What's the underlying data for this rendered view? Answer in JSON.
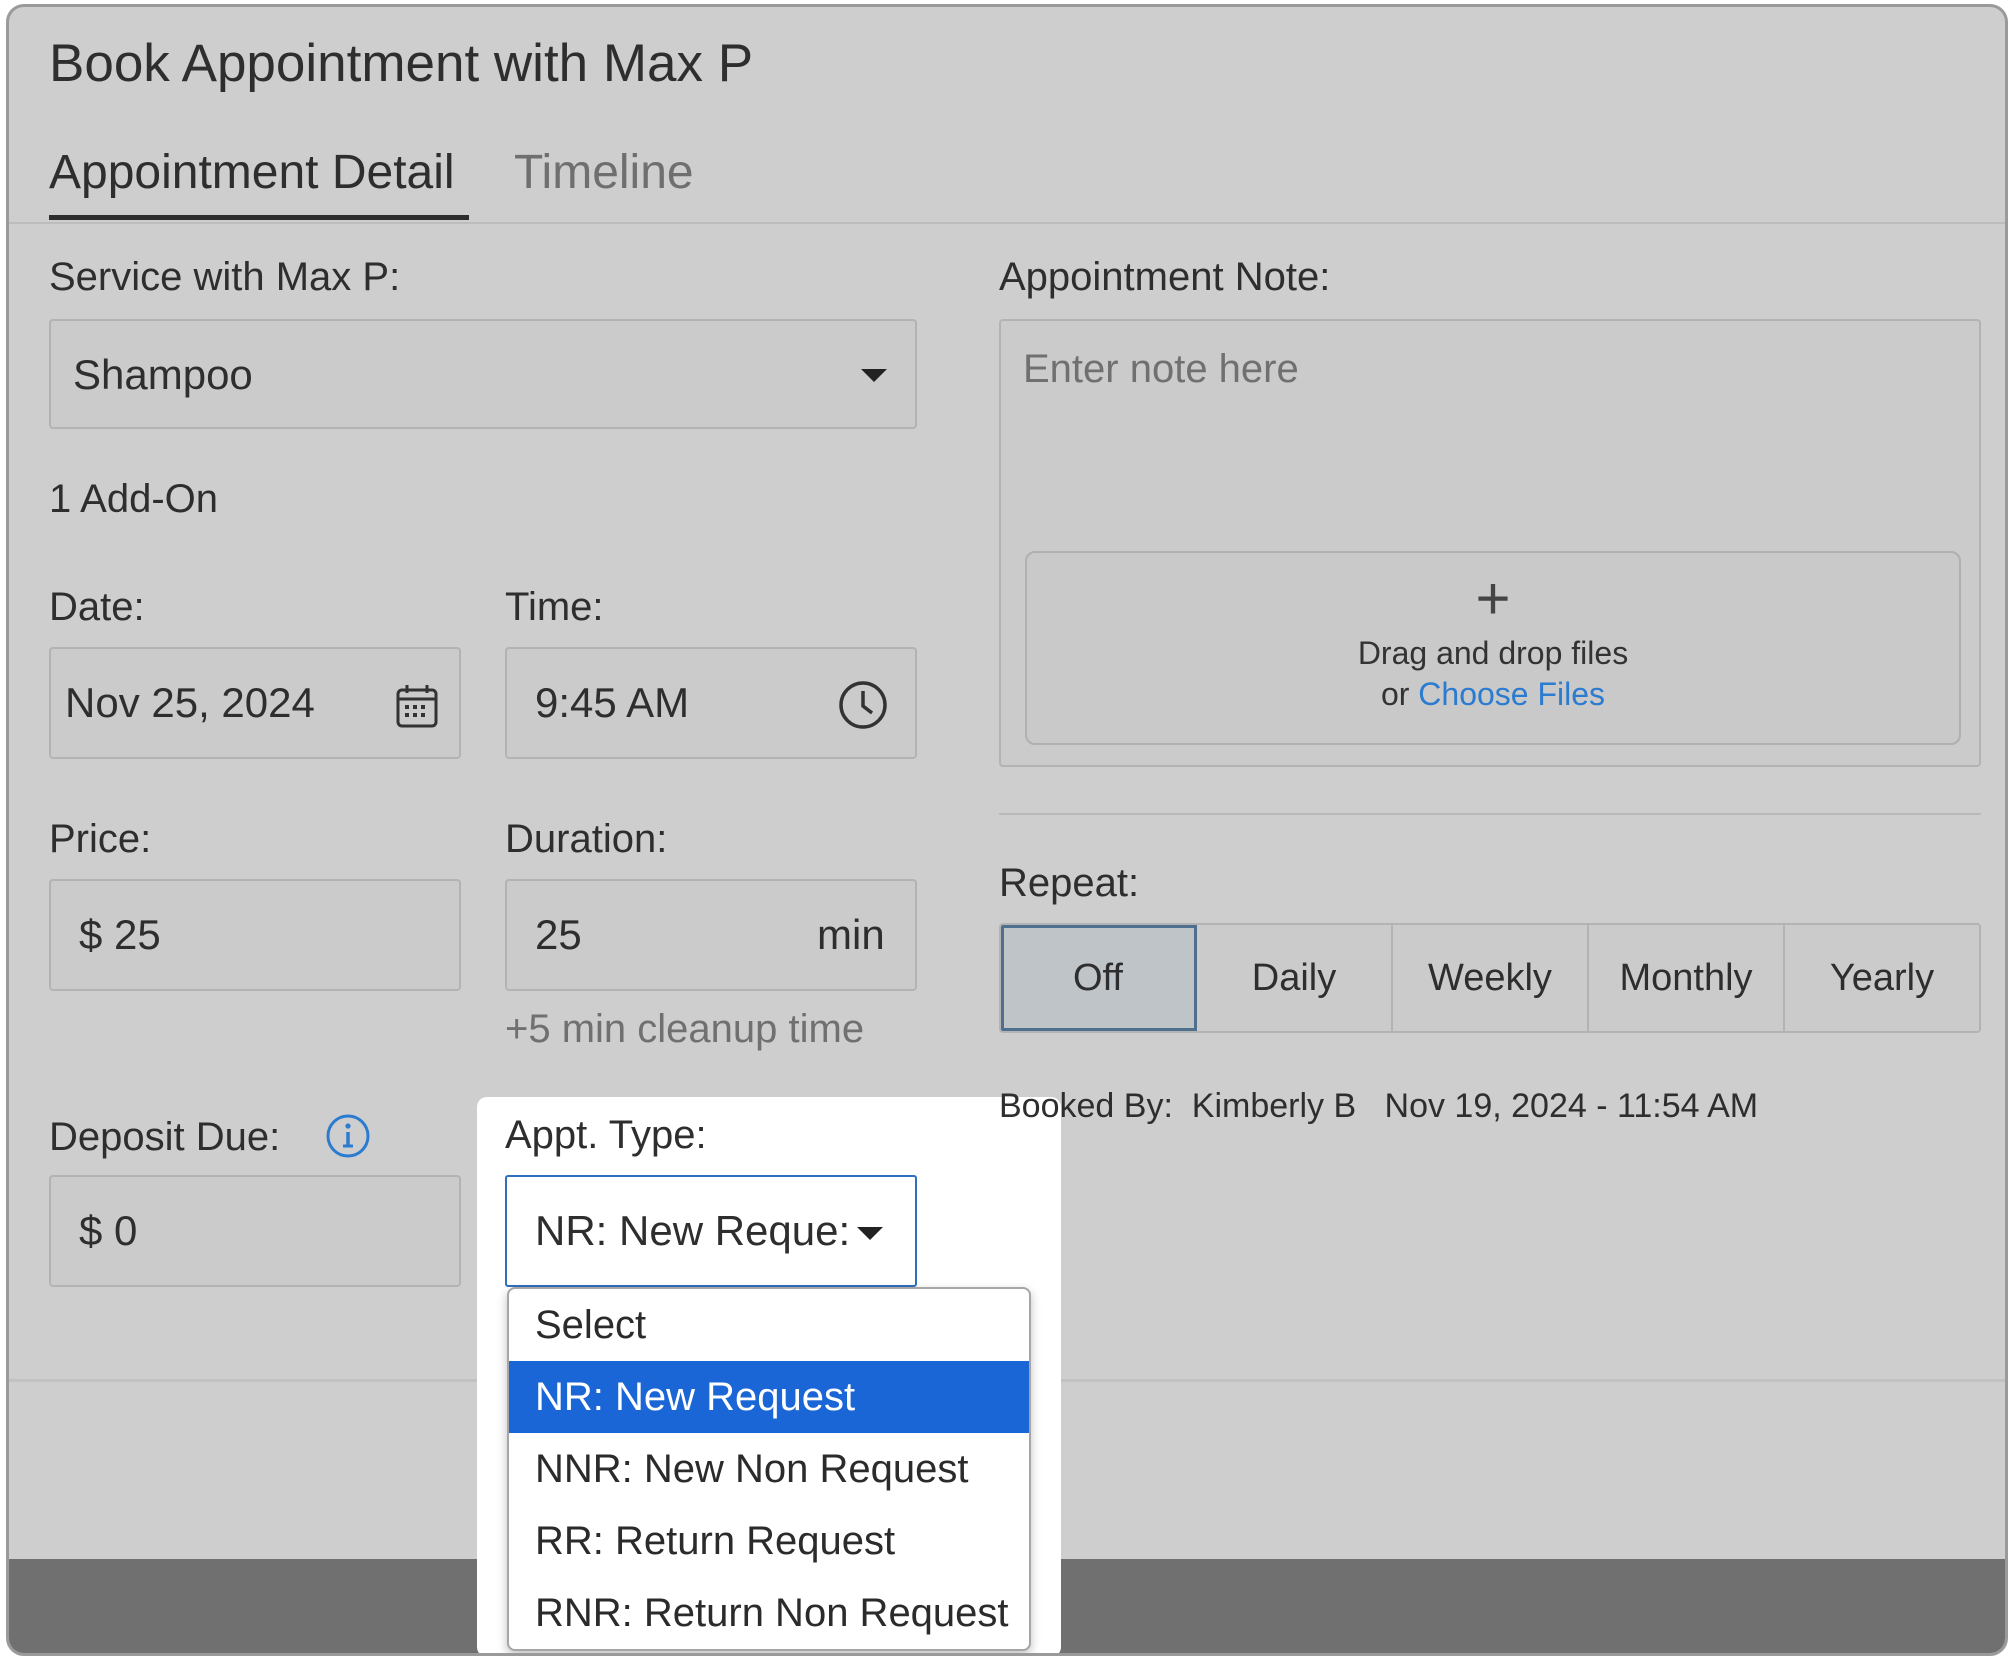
{
  "dialog": {
    "title": "Book Appointment with Max P"
  },
  "tabs": [
    {
      "label": "Appointment Detail",
      "active": true
    },
    {
      "label": "Timeline",
      "active": false
    }
  ],
  "service": {
    "label": "Service with Max P:",
    "value": "Shampoo"
  },
  "addons": "1 Add-On",
  "date": {
    "label": "Date:",
    "value": "Nov 25, 2024",
    "icon": "calendar-icon"
  },
  "time": {
    "label": "Time:",
    "value": "9:45 AM",
    "icon": "clock-icon"
  },
  "price": {
    "label": "Price:",
    "value": "$ 25"
  },
  "duration": {
    "label": "Duration:",
    "value": "25",
    "unit": "min",
    "cleanup": "+5 min cleanup time"
  },
  "deposit": {
    "label": "Deposit Due:",
    "value": "$ 0",
    "icon": "info-icon"
  },
  "appt_type": {
    "label": "Appt. Type:",
    "value": "NR: New Reque:",
    "options": [
      "Select",
      "NR: New Request",
      "NNR: New Non Request",
      "RR: Return Request",
      "RNR: Return Non Request"
    ],
    "selected_index": 1
  },
  "note": {
    "label": "Appointment Note:",
    "placeholder": "Enter note here"
  },
  "upload": {
    "plus": "+",
    "line1": "Drag and drop files",
    "or": "or",
    "choose": "Choose Files"
  },
  "repeat": {
    "label": "Repeat:",
    "options": [
      "Off",
      "Daily",
      "Weekly",
      "Monthly",
      "Yearly"
    ],
    "selected": "Off"
  },
  "booked": {
    "label": "Booked By:",
    "name": "Kimberly B",
    "datetime": "Nov 19, 2024 - 11:54 AM"
  },
  "colors": {
    "accent": "#1b66d6",
    "link": "#2b7bd0"
  }
}
